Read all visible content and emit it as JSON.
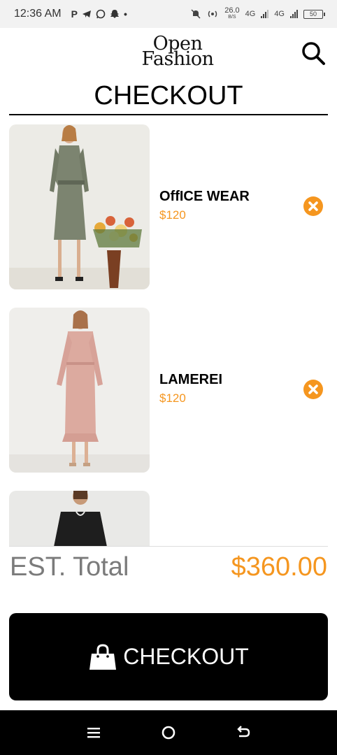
{
  "status_bar": {
    "time": "12:36 AM",
    "notification_icons": [
      "P",
      "telegram-icon",
      "whatsapp-icon",
      "snapchat-icon",
      "•"
    ],
    "speed_value": "26.0",
    "speed_unit": "B/S",
    "network_1": "4G",
    "network_2": "4G",
    "battery": "50"
  },
  "header": {
    "logo_line1": "Open",
    "logo_line2": "Fashion",
    "search_icon": "search-icon"
  },
  "page": {
    "title": "CHECKOUT"
  },
  "cart_items": [
    {
      "name": "OffICE WEAR",
      "price": "$120",
      "image": "woman in grey-green office dress with flowers"
    },
    {
      "name": "LAMEREI",
      "price": "$120",
      "image": "woman in pink long-sleeve dress"
    },
    {
      "name": "",
      "price": "",
      "image": "woman in black top"
    }
  ],
  "totals": {
    "label": "EST. Total",
    "value": "$360.00"
  },
  "checkout_button": {
    "label": "CHECKOUT",
    "icon": "shopping-bag-icon"
  },
  "colors": {
    "accent": "#f5961f",
    "total_label": "#7b7b7b",
    "button_bg": "#000000"
  }
}
